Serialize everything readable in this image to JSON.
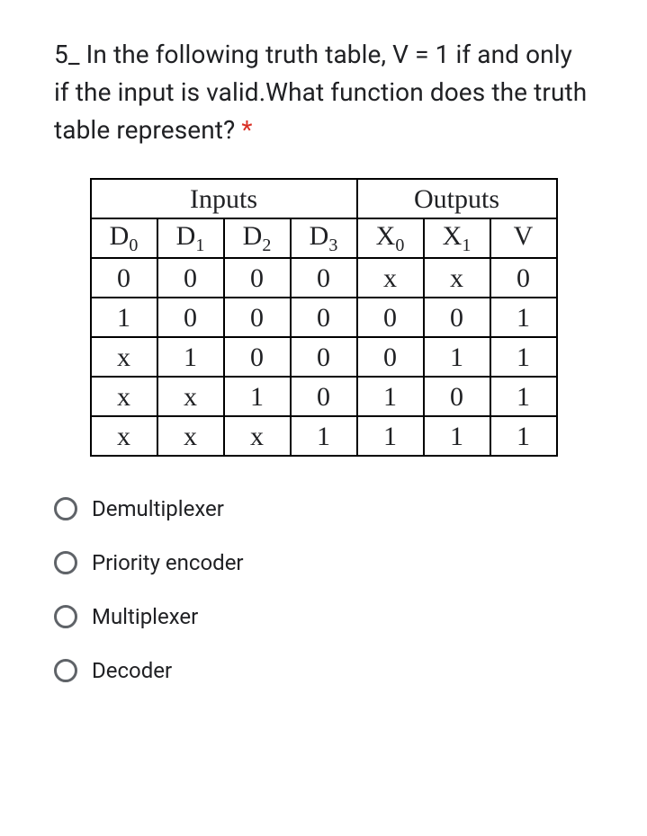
{
  "question": {
    "text": "5_ In the following truth table, V = 1 if and only if the input is valid.What function does the truth table represent?",
    "required_marker": "*"
  },
  "chart_data": {
    "type": "table",
    "group_headers": [
      "Inputs",
      "Outputs"
    ],
    "group_spans": [
      4,
      3
    ],
    "columns": [
      {
        "label": "D",
        "sub": "0"
      },
      {
        "label": "D",
        "sub": "1"
      },
      {
        "label": "D",
        "sub": "2"
      },
      {
        "label": "D",
        "sub": "3"
      },
      {
        "label": "X",
        "sub": "0"
      },
      {
        "label": "X",
        "sub": "1"
      },
      {
        "label": "V",
        "sub": ""
      }
    ],
    "rows": [
      [
        "0",
        "0",
        "0",
        "0",
        "x",
        "x",
        "0"
      ],
      [
        "1",
        "0",
        "0",
        "0",
        "0",
        "0",
        "1"
      ],
      [
        "x",
        "1",
        "0",
        "0",
        "0",
        "1",
        "1"
      ],
      [
        "x",
        "x",
        "1",
        "0",
        "1",
        "0",
        "1"
      ],
      [
        "x",
        "x",
        "x",
        "1",
        "1",
        "1",
        "1"
      ]
    ]
  },
  "options": [
    {
      "label": "Demultiplexer"
    },
    {
      "label": "Priority encoder"
    },
    {
      "label": "Multiplexer"
    },
    {
      "label": "Decoder"
    }
  ]
}
